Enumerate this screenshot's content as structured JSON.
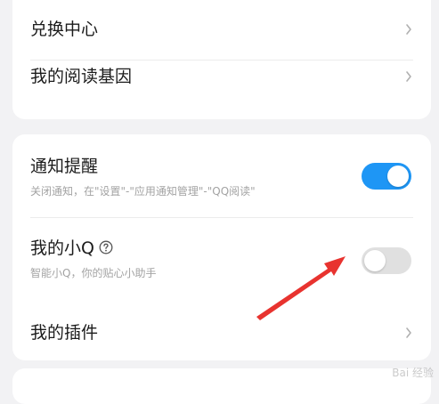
{
  "colors": {
    "accent": "#1e96f5",
    "toggle_off": "#e0e0e0",
    "arrow": "#e8332f"
  },
  "menu_top": {
    "items": [
      {
        "label": "兑换中心",
        "icon": "chevron-right-icon"
      },
      {
        "label": "我的阅读基因",
        "icon": "chevron-right-icon"
      }
    ]
  },
  "settings": {
    "notify": {
      "title": "通知提醒",
      "subtitle": "关闭通知，在\"设置\"-\"应用通知管理\"-\"QQ阅读\"",
      "toggle_on": true
    },
    "xiaoq": {
      "title": "我的小Q",
      "subtitle": "智能小Q，你的贴心小助手",
      "help_icon": "question-circle-icon",
      "toggle_on": false
    },
    "plugins": {
      "title": "我的插件",
      "icon": "chevron-right-icon"
    }
  },
  "overlay": {
    "annotation": "red-arrow-pointing-at-toggle"
  }
}
